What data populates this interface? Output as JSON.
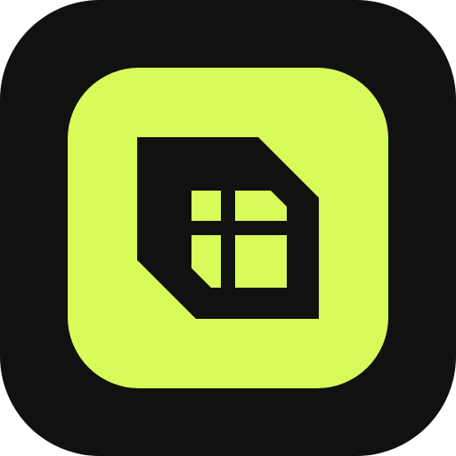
{
  "app_icon": {
    "name": "sim-card-icon",
    "colors": {
      "outer_background": "#111210",
      "tile_background": "#d9fb5a",
      "glyph": "#111210",
      "glyph_cutout": "#d9fb5a"
    }
  }
}
